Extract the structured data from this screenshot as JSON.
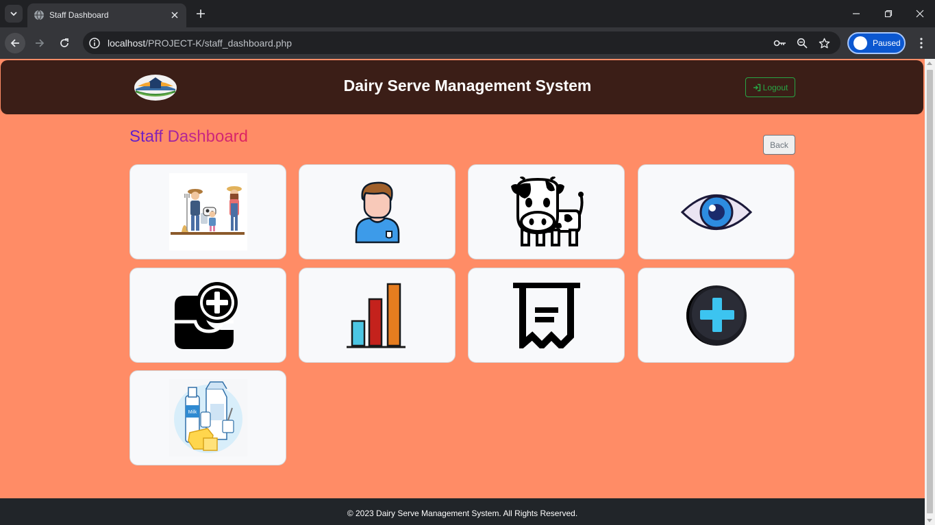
{
  "browser": {
    "tab_title": "Staff Dashboard",
    "url_host": "localhost",
    "url_path": "/PROJECT-K/staff_dashboard.php",
    "profile_label": "Paused",
    "colors": {
      "chrome_dark": "#202124",
      "chrome_toolbar": "#35363a",
      "profile_blue": "#0b57d0"
    }
  },
  "header": {
    "title": "Dairy Serve Management System",
    "logout_label": "Logout",
    "logo_icon": "farm-logo-icon",
    "colors": {
      "background": "#3b1e17",
      "logout": "#28a745"
    }
  },
  "page": {
    "heading": "Staff Dashboard",
    "back_label": "Back",
    "background": "#ff8c66"
  },
  "cards": [
    {
      "icon": "farmers-family-illustration-icon"
    },
    {
      "icon": "staff-user-icon"
    },
    {
      "icon": "cow-icon"
    },
    {
      "icon": "eye-view-icon"
    },
    {
      "icon": "add-record-icon"
    },
    {
      "icon": "bar-chart-icon"
    },
    {
      "icon": "receipt-icon"
    },
    {
      "icon": "plus-circle-icon"
    },
    {
      "icon": "dairy-products-illustration-icon"
    }
  ],
  "footer": {
    "text": "© 2023 Dairy Serve Management System. All Rights Reserved."
  }
}
